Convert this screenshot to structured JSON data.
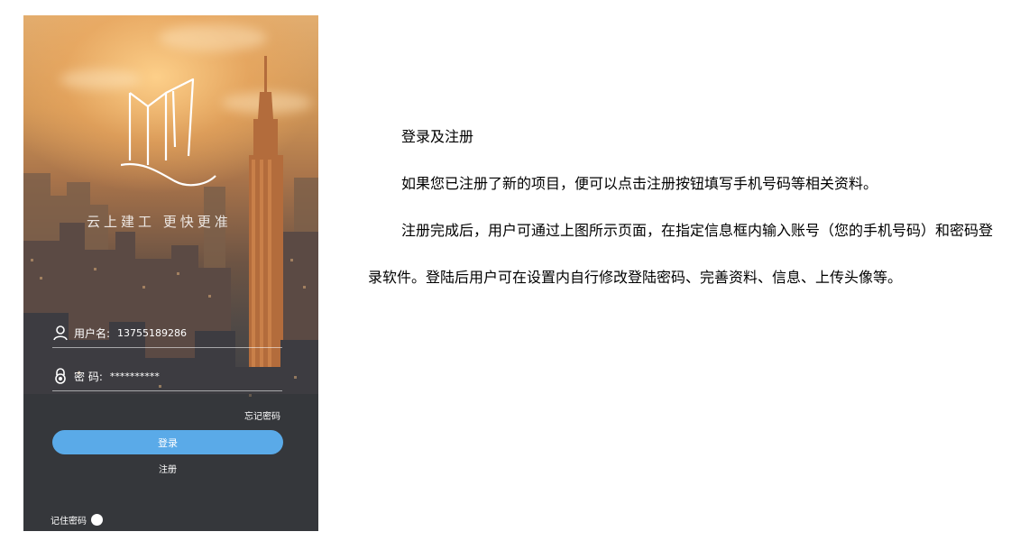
{
  "phone": {
    "slogan": "云上建工 更快更准",
    "username": {
      "icon": "user-icon",
      "label": "用户名:",
      "value": "13755189286"
    },
    "password": {
      "icon": "lock-icon",
      "label": "密 码:",
      "value": "**********"
    },
    "forgot_password": "忘记密码",
    "login_button": "登录",
    "register_link": "注册",
    "remember_password": "记住密码",
    "colors": {
      "login_button": "#5aaae8",
      "text": "#ffffff"
    }
  },
  "document": {
    "heading": "登录及注册",
    "paragraph1": "如果您已注册了新的项目，便可以点击注册按钮填写手机号码等相关资料。",
    "paragraph2": "注册完成后，用户可通过上图所示页面，在指定信息框内输入账号（您的手机号码）和密码登录软件。登陆后用户可在设置内自行修改登陆密码、完善资料、信息、上传头像等。"
  }
}
